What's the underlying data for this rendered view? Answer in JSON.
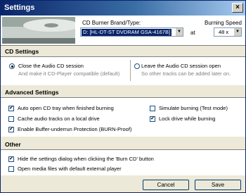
{
  "window": {
    "title": "Settings",
    "close_glyph": "×"
  },
  "header": {
    "burner_label": "CD Burner Brand/Type:",
    "burner_value": "D: [HL-DT-ST DVDRAM GSA-4167B]",
    "at_label": "at",
    "speed_label": "Burning Speed",
    "speed_value": "48 x"
  },
  "cd_settings": {
    "heading": "CD Settings",
    "option_close": {
      "label": "Close the Audio CD session",
      "sub": "And make it CD-Player compatible (default)",
      "selected": true
    },
    "option_leave": {
      "label": "Leave the Audio CD session open",
      "sub": "So other tracks can be added later on.",
      "selected": false
    }
  },
  "advanced": {
    "heading": "Advanced Settings",
    "auto_open": {
      "label": "Auto open CD tray when finished burning",
      "checked": true
    },
    "cache": {
      "label": "Cache audio tracks on a local drive",
      "checked": false
    },
    "buffer": {
      "label": "Enable Buffer-underrun Protection (BURN-Proof)",
      "checked": true
    },
    "simulate": {
      "label": "Simulate burning (Test mode)",
      "checked": false
    },
    "lock": {
      "label": "Lock drive while burning",
      "checked": true
    }
  },
  "other": {
    "heading": "Other",
    "hide_dialog": {
      "label": "Hide the settings dialog when clicking the 'Burn CD' button",
      "checked": true
    },
    "open_media": {
      "label": "Open media files with default external player",
      "checked": false
    }
  },
  "footer": {
    "cancel_label": "Cancel",
    "save_label": "Save"
  },
  "colors": {
    "titlebar": "#0a246a",
    "panel": "#ffffff",
    "dialog": "#ece9d8"
  },
  "icons": {
    "check": "✔",
    "dropdown": "▼"
  }
}
